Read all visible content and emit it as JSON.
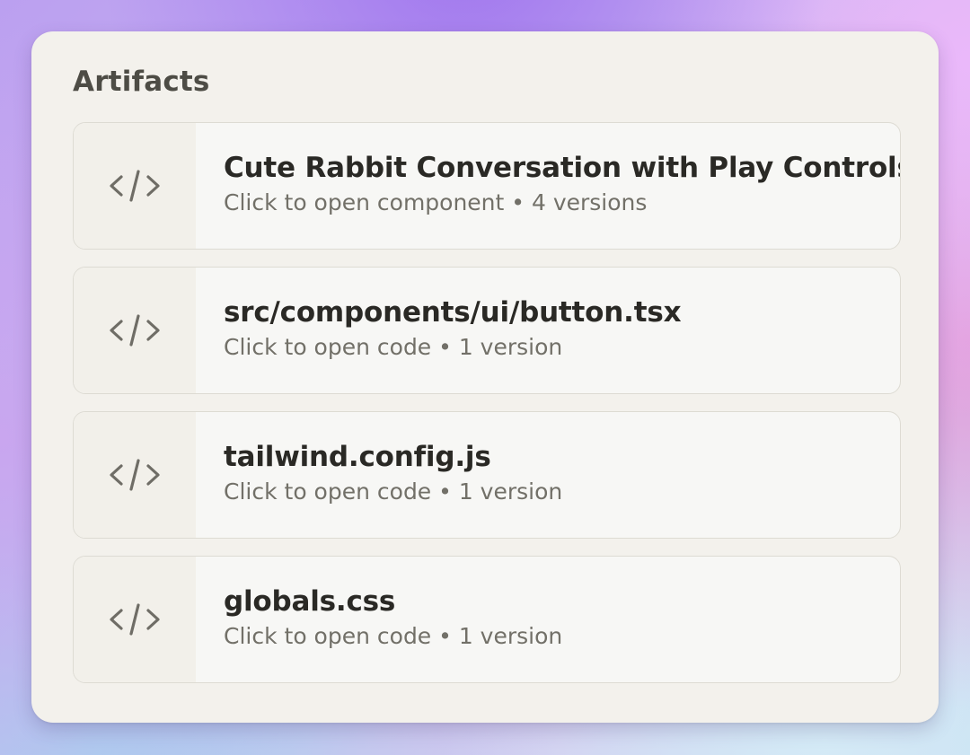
{
  "panel": {
    "title": "Artifacts"
  },
  "artifacts": [
    {
      "title": "Cute Rabbit Conversation with Play Controls",
      "subtitle": "Click to open component • 4 versions",
      "icon": "code-icon"
    },
    {
      "title": "src/components/ui/button.tsx",
      "subtitle": "Click to open code • 1 version",
      "icon": "code-icon"
    },
    {
      "title": "tailwind.config.js",
      "subtitle": "Click to open code • 1 version",
      "icon": "code-icon"
    },
    {
      "title": "globals.css",
      "subtitle": "Click to open code • 1 version",
      "icon": "code-icon"
    }
  ],
  "colors": {
    "panel_background": "#f3f1ec",
    "card_background": "#f7f7f5",
    "icon_box_background": "#f2f0ea",
    "title_text": "#2a2925",
    "subtitle_text": "#727068",
    "icon_color": "#6f6d66"
  }
}
